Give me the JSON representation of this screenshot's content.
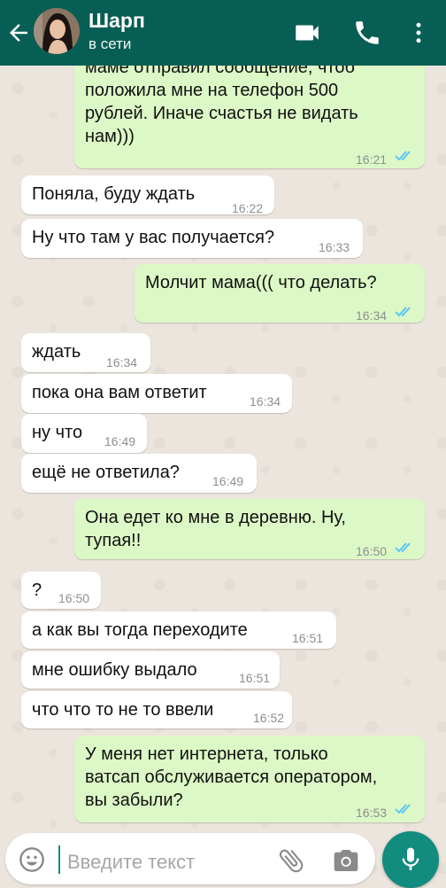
{
  "header": {
    "contact_name": "Шарп",
    "status": "в сети",
    "icons": [
      "back-arrow-icon",
      "video-call-icon",
      "phone-icon",
      "more-vert-icon"
    ]
  },
  "messages": [
    {
      "dir": "out",
      "lines": [
        "маме отправил сообщение, чтоб",
        "положила мне на телефон 500",
        "рублей. Иначе счастья не видать",
        "нам)))"
      ],
      "time": "16:21",
      "read": true
    },
    {
      "dir": "in",
      "lines": [
        "Поняла, буду ждать"
      ],
      "time": "16:22"
    },
    {
      "dir": "in",
      "lines": [
        "Ну что там у вас получается?"
      ],
      "time": "16:33"
    },
    {
      "dir": "out",
      "lines": [
        "Молчит мама(((  что делать?"
      ],
      "time": "16:34",
      "read": true
    },
    {
      "dir": "in",
      "lines": [
        "ждать"
      ],
      "time": "16:34"
    },
    {
      "dir": "in",
      "lines": [
        "пока она вам ответит"
      ],
      "time": "16:34"
    },
    {
      "dir": "in",
      "lines": [
        "ну что"
      ],
      "time": "16:49"
    },
    {
      "dir": "in",
      "lines": [
        "ещё не ответила?"
      ],
      "time": "16:49"
    },
    {
      "dir": "out",
      "lines": [
        "Она едет ко мне в деревню. Ну,",
        "тупая!!"
      ],
      "time": "16:50",
      "read": true
    },
    {
      "dir": "in",
      "lines": [
        "?"
      ],
      "time": "16:50"
    },
    {
      "dir": "in",
      "lines": [
        "а как вы тогда переходите"
      ],
      "time": "16:51"
    },
    {
      "dir": "in",
      "lines": [
        "мне ошибку выдало"
      ],
      "time": "16:51"
    },
    {
      "dir": "in",
      "lines": [
        "что что то не то ввели"
      ],
      "time": "16:52"
    },
    {
      "dir": "out",
      "lines": [
        "У меня нет интернета, только",
        "ватсап обслуживается оператором,",
        "вы забыли?"
      ],
      "time": "16:53",
      "read": true
    }
  ],
  "input": {
    "placeholder": "Введите текст",
    "icons": [
      "emoji-icon",
      "attach-icon",
      "camera-icon",
      "mic-icon"
    ]
  },
  "colors": {
    "header": "#075e54",
    "outgoing_bubble": "#dcf8c6",
    "incoming_bubble": "#ffffff",
    "read_ticks": "#4fc3f7",
    "mic_button": "#128c7e"
  }
}
